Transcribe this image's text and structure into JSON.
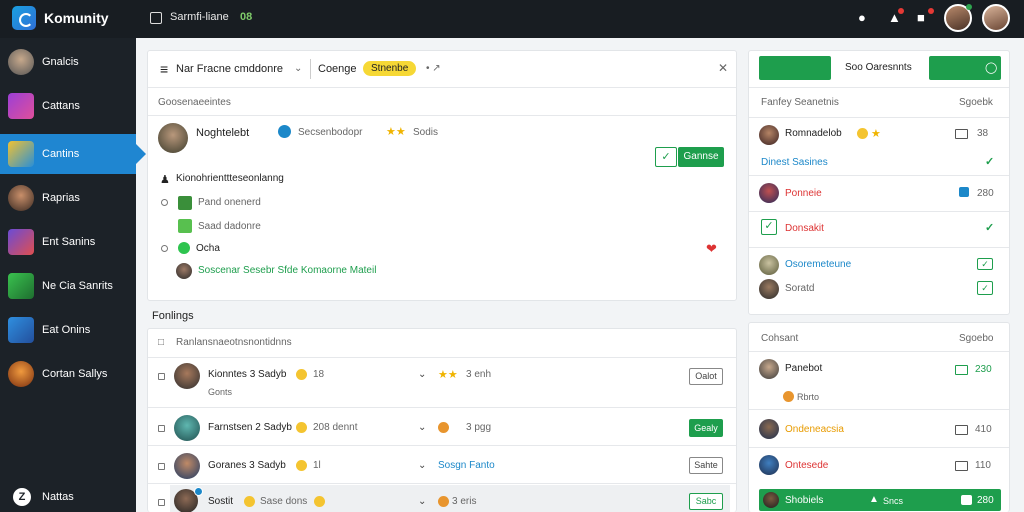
{
  "topbar": {
    "brand": "Komunity",
    "search_label": "Sarmfi-liane",
    "search_badge": "08"
  },
  "sidebar": {
    "items": [
      {
        "label": "Gnalcis"
      },
      {
        "label": "Cattans"
      },
      {
        "label": "Cantins"
      },
      {
        "label": "Raprias"
      },
      {
        "label": "Ent Sanins"
      },
      {
        "label": "Ne Cia Sanrits"
      },
      {
        "label": "Eat Onins"
      },
      {
        "label": "Cortan Sallys"
      }
    ],
    "footer": "Nattas",
    "footer_icon": "Z"
  },
  "main_card": {
    "title": "Nar Fracne cmddonre",
    "tab": "Coenge",
    "chip": "Stnenbe",
    "section": "Goosenaeeintes",
    "author": "Noghtelebt",
    "author_meta": "Secsenbodopr",
    "author_rating": "Sodis",
    "action_button": "Gannse",
    "subheading": "Kionohrienttteseonlanng",
    "options": [
      {
        "label": "Pand onenerd"
      },
      {
        "label": "Saad dadonre"
      },
      {
        "label": "Ocha"
      }
    ],
    "link": "Soscenar Sesebr Sfde Komaorne Mateil"
  },
  "list_section_title": "Fonlings",
  "list_card": {
    "header": "Ranlansnaeotnsnontidnns",
    "rows": [
      {
        "name": "Kionntes 3 Sadyb",
        "count": "18",
        "sub": "Gonts",
        "meta": "3 enh",
        "button": "Oalot"
      },
      {
        "name": "Farnstsen 2 Sadyb",
        "count": "208 dennt",
        "meta": "3 pgg",
        "button": "Gealy"
      },
      {
        "name": "Goranes 3 Sadyb",
        "count": "1l",
        "meta": "Sosgn Fanto",
        "button": "Sahte"
      },
      {
        "name": "Sostit",
        "count": "Sase dons",
        "meta": "3 eris",
        "button": "Sabc"
      }
    ]
  },
  "right_top": {
    "tab_center": "Soo Oaresnnts",
    "section": "Fanfey Seanetnis",
    "section_right": "Sgoebk",
    "rows": [
      {
        "name": "Romnadelob",
        "value": "38",
        "sub": "Dinest Sasines"
      },
      {
        "name": "Ponneie",
        "value": "280"
      },
      {
        "name": "Donsakit"
      },
      {
        "name": "Osoremeteune"
      },
      {
        "name": "Soratd"
      }
    ]
  },
  "right_bottom": {
    "section": "Cohsant",
    "section_right": "Sgoebo",
    "rows": [
      {
        "name": "Panebot",
        "value": "230",
        "sub": "Rbrto"
      },
      {
        "name": "Ondeneacsia",
        "value": "410"
      },
      {
        "name": "Ontesede",
        "value": "110"
      },
      {
        "name": "Shobiels",
        "value": "280",
        "meta": "Sncs"
      }
    ]
  },
  "colors": {
    "accent": "#1e9e4d",
    "sidebar": "#1c2228",
    "active": "#1f86d1",
    "topbar": "#181d22"
  }
}
